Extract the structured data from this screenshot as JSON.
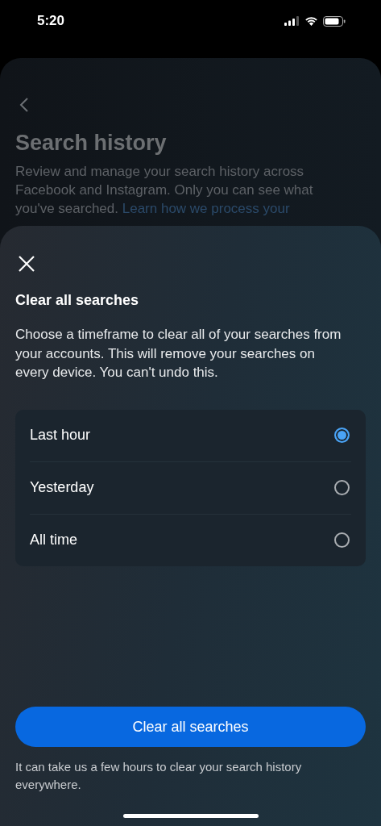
{
  "status_bar": {
    "time": "5:20"
  },
  "background_page": {
    "title": "Search history",
    "description": "Review and manage your search history across Facebook and Instagram. Only you can see what you've searched.",
    "link": "Learn how we process your"
  },
  "sheet": {
    "title": "Clear all searches",
    "description": "Choose a timeframe to clear all of your searches from your accounts. This will remove your searches on every device. You can't undo this.",
    "options": [
      {
        "label": "Last hour",
        "selected": true
      },
      {
        "label": "Yesterday",
        "selected": false
      },
      {
        "label": "All time",
        "selected": false
      }
    ],
    "button": "Clear all searches",
    "footnote": "It can take us a few hours to clear your search history everywhere."
  }
}
